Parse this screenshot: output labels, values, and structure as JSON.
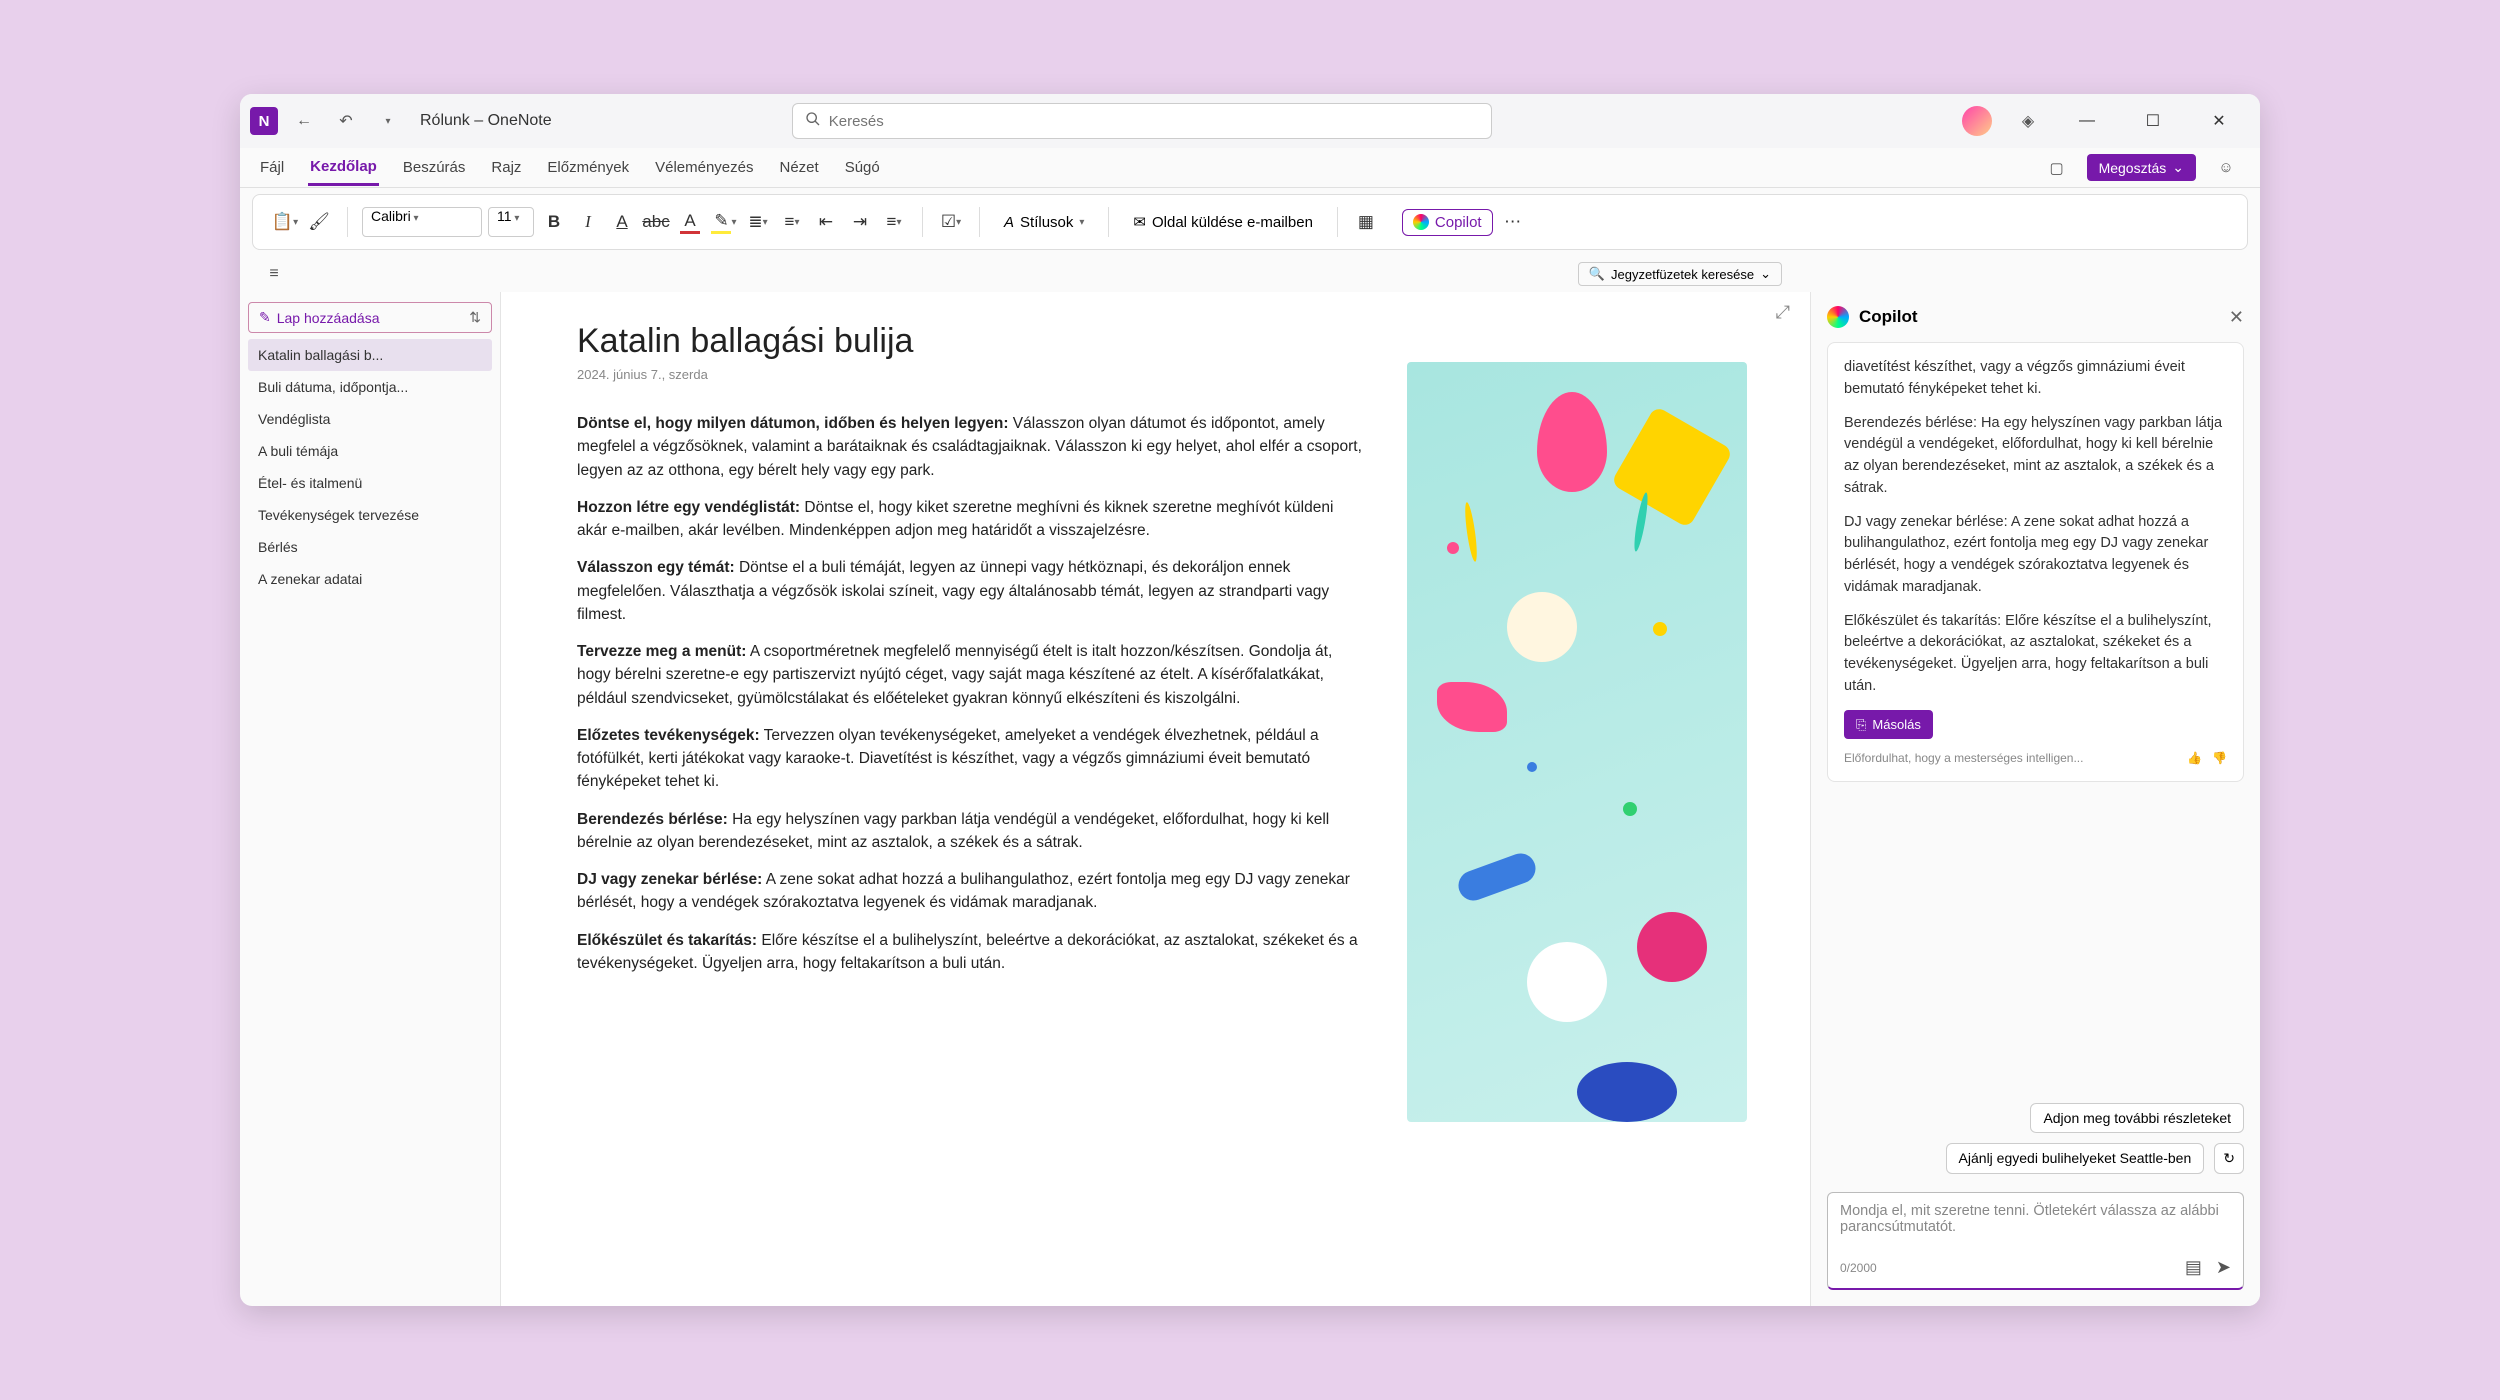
{
  "titlebar": {
    "title": "Rólunk – OneNote",
    "search_placeholder": "Keresés"
  },
  "menubar": {
    "items": [
      "Fájl",
      "Kezdőlap",
      "Beszúrás",
      "Rajz",
      "Előzmények",
      "Véleményezés",
      "Nézet",
      "Súgó"
    ],
    "active_index": 1,
    "share": "Megosztás"
  },
  "ribbon": {
    "font_name": "Calibri",
    "font_size": "11",
    "styles": "Stílusok",
    "email": "Oldal küldése e-mailben",
    "copilot": "Copilot"
  },
  "subbar": {
    "notebook_search": "Jegyzetfüzetek keresése"
  },
  "pagelist": {
    "add_page": "Lap hozzáadása",
    "items": [
      "Katalin ballagási b...",
      "Buli dátuma, időpontja...",
      "Vendéglista",
      "A buli témája",
      "Étel- és italmenü",
      "Tevékenységek tervezése",
      "Bérlés",
      "A zenekar adatai"
    ],
    "selected_index": 0
  },
  "page": {
    "title": "Katalin ballagási bulija",
    "date": "2024. június 7., szerda",
    "paragraphs": [
      {
        "bold": "Döntse el, hogy milyen dátumon, időben és helyen legyen:",
        "text": " Válasszon olyan dátumot és időpontot, amely megfelel a végzősöknek, valamint a barátaiknak és családtagjaiknak. Válasszon ki egy helyet, ahol elfér a csoport, legyen az az otthona, egy bérelt hely vagy egy park."
      },
      {
        "bold": "Hozzon létre egy vendéglistát:",
        "text": " Döntse el, hogy kiket szeretne meghívni és kiknek szeretne meghívót küldeni akár e-mailben, akár levélben. Mindenképpen adjon meg határidőt a visszajelzésre."
      },
      {
        "bold": "Válasszon egy témát:",
        "text": " Döntse el a buli témáját, legyen az ünnepi vagy hétköznapi, és dekoráljon ennek megfelelően. Választhatja a végzősök iskolai színeit, vagy egy általánosabb témát, legyen az strandparti vagy filmest."
      },
      {
        "bold": "Tervezze meg a menüt:",
        "text": " A csoportméretnek megfelelő mennyiségű ételt is italt hozzon/készítsen. Gondolja át, hogy bérelni szeretne-e egy partiszervizt nyújtó céget, vagy saját maga készítené az ételt. A kísérőfalatkákat, például szendvicseket, gyümölcstálakat és előételeket gyakran könnyű elkészíteni és kiszolgálni."
      },
      {
        "bold": "Előzetes tevékenységek:",
        "text": " Tervezzen olyan tevékenységeket, amelyeket a vendégek élvezhetnek, például a fotófülkét, kerti játékokat vagy karaoke-t. Diavetítést is készíthet, vagy a végzős gimnáziumi éveit bemutató fényképeket tehet ki."
      },
      {
        "bold": "Berendezés bérlése:",
        "text": " Ha egy helyszínen vagy parkban látja vendégül a vendégeket, előfordulhat, hogy ki kell bérelnie az olyan berendezéseket, mint az asztalok, a székek és a sátrak."
      },
      {
        "bold": "DJ vagy zenekar bérlése:",
        "text": " A zene sokat adhat hozzá a bulihangulathoz, ezért fontolja meg egy DJ vagy zenekar bérlését, hogy a vendégek szórakoztatva legyenek és vidámak maradjanak."
      },
      {
        "bold": "Előkészület és takarítás:",
        "text": " Előre készítse el a bulihelyszínt, beleértve a dekorációkat, az asztalokat, székeket és a tevékenységeket. Ügyeljen arra, hogy feltakarítson a buli után."
      }
    ]
  },
  "copilot": {
    "title": "Copilot",
    "message_parts": [
      "diavetítést készíthet, vagy a végzős gimnáziumi éveit bemutató fényképeket tehet ki.",
      "Berendezés bérlése: Ha egy helyszínen vagy parkban látja vendégül a vendégeket, előfordulhat, hogy ki kell bérelnie az olyan berendezéseket, mint az asztalok, a székek és a sátrak.",
      "DJ vagy zenekar bérlése: A zene sokat adhat hozzá a bulihangulathoz, ezért fontolja meg egy DJ vagy zenekar bérlését, hogy a vendégek szórakoztatva legyenek és vidámak maradjanak.",
      "Előkészület és takarítás: Előre készítse el a bulihelyszínt, beleértve a dekorációkat, az asztalokat, székeket és a tevékenységeket. Ügyeljen arra, hogy feltakarítson a buli után."
    ],
    "copy": "Másolás",
    "disclaimer": "Előfordulhat, hogy a mesterséges intelligen...",
    "suggestions": [
      "Adjon meg további részleteket",
      "Ajánlj egyedi bulihelyeket Seattle-ben"
    ],
    "input_placeholder": "Mondja el, mit szeretne tenni. Ötletekért válassza az alábbi parancsútmutatót.",
    "counter": "0/2000"
  }
}
